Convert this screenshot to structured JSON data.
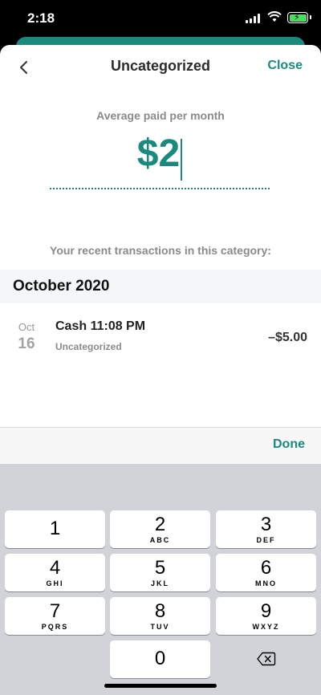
{
  "status_bar": {
    "time": "2:18"
  },
  "nav": {
    "title": "Uncategorized",
    "close_label": "Close"
  },
  "average": {
    "label": "Average paid per month",
    "value": "$2"
  },
  "recent": {
    "label": "Your recent transactions in this category:"
  },
  "month_header": "October 2020",
  "transaction": {
    "month": "Oct",
    "day": "16",
    "title": "Cash 11:08 PM",
    "category": "Uncategorized",
    "amount": "–$5.00"
  },
  "toolbar": {
    "done_label": "Done"
  },
  "keypad": {
    "keys": [
      {
        "num": "1",
        "letters": ""
      },
      {
        "num": "2",
        "letters": "ABC"
      },
      {
        "num": "3",
        "letters": "DEF"
      },
      {
        "num": "4",
        "letters": "GHI"
      },
      {
        "num": "5",
        "letters": "JKL"
      },
      {
        "num": "6",
        "letters": "MNO"
      },
      {
        "num": "7",
        "letters": "PQRS"
      },
      {
        "num": "8",
        "letters": "TUV"
      },
      {
        "num": "9",
        "letters": "WXYZ"
      },
      {
        "num": "0",
        "letters": ""
      }
    ]
  },
  "colors": {
    "accent": "#1a8a7e",
    "battery": "#4cd964"
  }
}
